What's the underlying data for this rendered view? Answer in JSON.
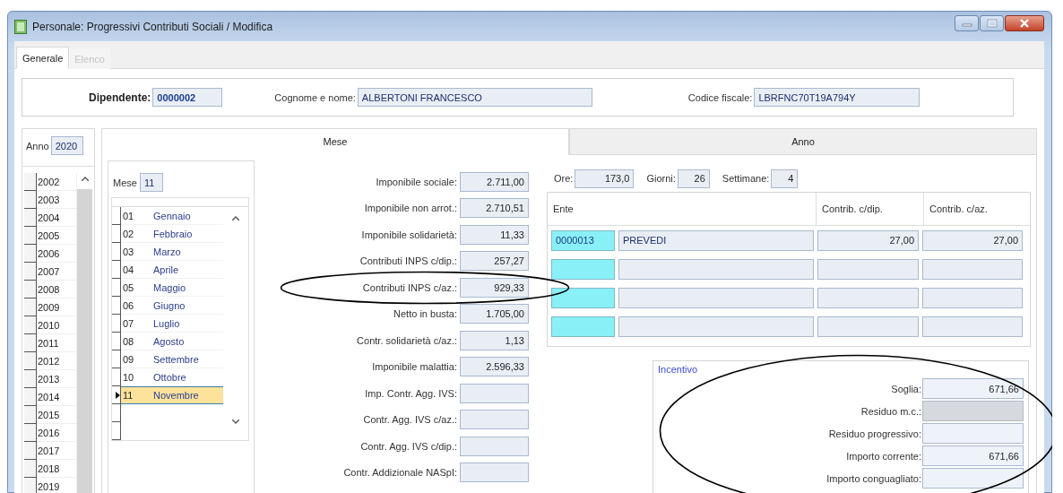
{
  "window": {
    "title": "Personale: Progressivi Contributi Sociali / Modifica"
  },
  "tabs": [
    {
      "label": "Generale",
      "selected": true,
      "disabled": false
    },
    {
      "label": "Elenco",
      "selected": false,
      "disabled": true
    }
  ],
  "employee": [
    {
      "label": "Dipendente:",
      "value": "0000002",
      "kind": "code"
    },
    {
      "label": "Cognome e nome:",
      "value": "ALBERTONI FRANCESCO",
      "kind": "text"
    },
    {
      "label": "Codice fiscale:",
      "value": "LBRFNC70T19A794Y",
      "kind": "text"
    }
  ],
  "year_panel": {
    "label": "Anno",
    "value": "2020",
    "years": [
      "2002",
      "2003",
      "2004",
      "2005",
      "2006",
      "2007",
      "2008",
      "2009",
      "2010",
      "2011",
      "2012",
      "2013",
      "2014",
      "2015",
      "2016",
      "2017",
      "2018",
      "2019"
    ]
  },
  "section_tabs": [
    {
      "label": "Mese",
      "selected": true
    },
    {
      "label": "Anno",
      "selected": false
    }
  ],
  "month_panel": {
    "label": "Mese",
    "value": "11",
    "months": [
      {
        "number": "01",
        "name": "Gennaio",
        "selected": false
      },
      {
        "number": "02",
        "name": "Febbraio",
        "selected": false
      },
      {
        "number": "03",
        "name": "Marzo",
        "selected": false
      },
      {
        "number": "04",
        "name": "Aprile",
        "selected": false
      },
      {
        "number": "05",
        "name": "Maggio",
        "selected": false
      },
      {
        "number": "06",
        "name": "Giugno",
        "selected": false
      },
      {
        "number": "07",
        "name": "Luglio",
        "selected": false
      },
      {
        "number": "08",
        "name": "Agosto",
        "selected": false
      },
      {
        "number": "09",
        "name": "Settembre",
        "selected": false
      },
      {
        "number": "10",
        "name": "Ottobre",
        "selected": false
      },
      {
        "number": "11",
        "name": "Novembre",
        "selected": true
      }
    ]
  },
  "amounts": [
    {
      "label": "Imponibile sociale:",
      "value": "2.711,00",
      "circled": false
    },
    {
      "label": "Imponibile non arrot.:",
      "value": "2.710,51",
      "circled": false
    },
    {
      "label": "Imponibile solidarietà:",
      "value": "11,33",
      "circled": false
    },
    {
      "label": "Contributi INPS c/dip.:",
      "value": "257,27",
      "circled": false
    },
    {
      "label": "Contributi INPS c/az.:",
      "value": "929,33",
      "circled": true
    },
    {
      "label": "Netto in busta:",
      "value": "1.705,00",
      "circled": false
    },
    {
      "label": "Contr. solidarietà c/az.:",
      "value": "1,13",
      "circled": false
    },
    {
      "label": "Imponibile malattia:",
      "value": "2.596,33",
      "circled": false
    },
    {
      "label": "Imp. Contr. Agg. IVS:",
      "circled": false
    },
    {
      "label": "Contr. Agg. IVS c/az.:",
      "circled": false
    },
    {
      "label": "Contr. Agg. IVS c/dip.:",
      "circled": false
    },
    {
      "label": "Contr. Addizionale NASpI:",
      "circled": false
    }
  ],
  "time_counts": [
    {
      "label": "Ore:",
      "value": "173,0"
    },
    {
      "label": "Giorni:",
      "value": "26"
    },
    {
      "label": "Settimane:",
      "value": "4"
    }
  ],
  "ente_table": {
    "columns": [
      "Ente",
      "Contrib. c/dip.",
      "Contrib. c/az."
    ],
    "rows": [
      {
        "code": "0000013",
        "name": "PREVEDI",
        "contrib_dip": "27,00",
        "contrib_az": "27,00"
      },
      {},
      {},
      {}
    ]
  },
  "incentive": {
    "title": "Incentivo",
    "circled": true,
    "fields": [
      {
        "label": "Soglia:",
        "value": "671,66",
        "disabled": false
      },
      {
        "label": "Residuo m.c.:",
        "disabled": true
      },
      {
        "label": "Residuo progressivo:",
        "disabled": false
      },
      {
        "label": "Importo corrente:",
        "value": "671,66",
        "disabled": false
      },
      {
        "label": "Importo conguagliato:",
        "disabled": false
      }
    ]
  }
}
